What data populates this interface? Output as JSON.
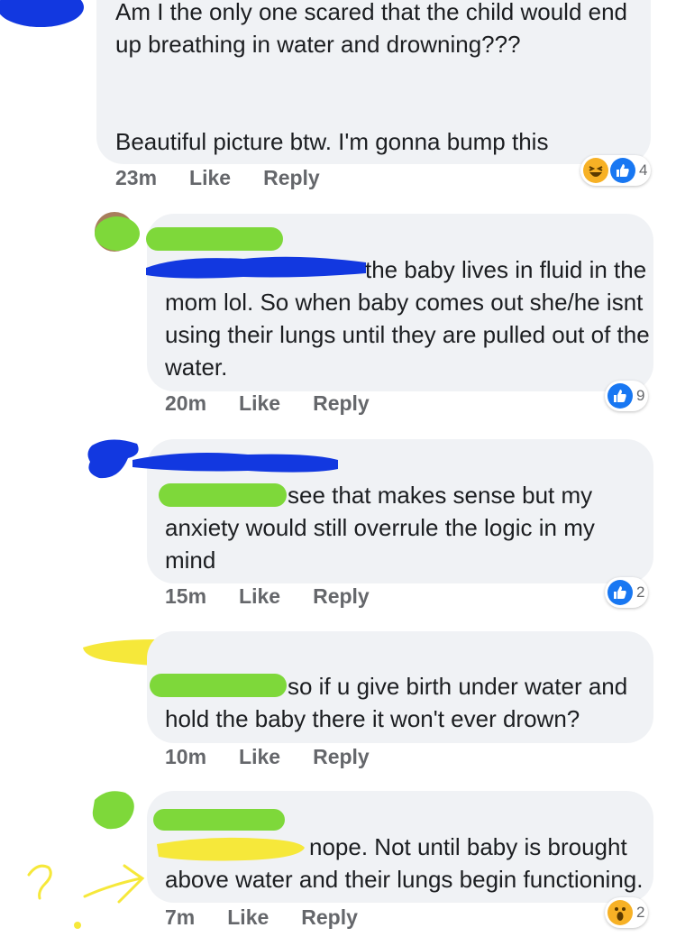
{
  "comments": [
    {
      "text": "Am I the only one scared that the child would end\nup breathing in water and drowning???\n\n\nBeautiful picture btw. I'm gonna bump this",
      "time": "23m",
      "like": "Like",
      "reply": "Reply",
      "reactions": [
        "haha-icon",
        "like-icon"
      ],
      "reaction_count": "4"
    },
    {
      "text": "the baby lives in fluid in the\nmom lol. So when baby comes out she/he isnt\nusing their lungs until they are pulled out of the\nwater.",
      "time": "20m",
      "like": "Like",
      "reply": "Reply",
      "reactions": [
        "like-icon"
      ],
      "reaction_count": "9"
    },
    {
      "text": "see that makes sense but my\nanxiety would still overrule the logic in my\nmind",
      "time": "15m",
      "like": "Like",
      "reply": "Reply",
      "reactions": [
        "like-icon"
      ],
      "reaction_count": "2"
    },
    {
      "text": "so if u give birth under water and\nhold the baby there it won't ever drown?",
      "time": "10m",
      "like": "Like",
      "reply": "Reply",
      "reactions": [],
      "reaction_count": ""
    },
    {
      "text": "nope. Not until baby is brought\nabove water and their lungs begin functioning.",
      "time": "7m",
      "like": "Like",
      "reply": "Reply",
      "reactions": [
        "wow-icon"
      ],
      "reaction_count": "2"
    }
  ],
  "colors": {
    "bubble": "#f0f2f5",
    "meta_text": "#65676b",
    "like_blue": "#1877f2",
    "emoji_yellow": "#f7b125",
    "redact_blue": "#1238e0",
    "redact_green": "#7ed83a",
    "redact_yellow": "#f6e83a"
  }
}
